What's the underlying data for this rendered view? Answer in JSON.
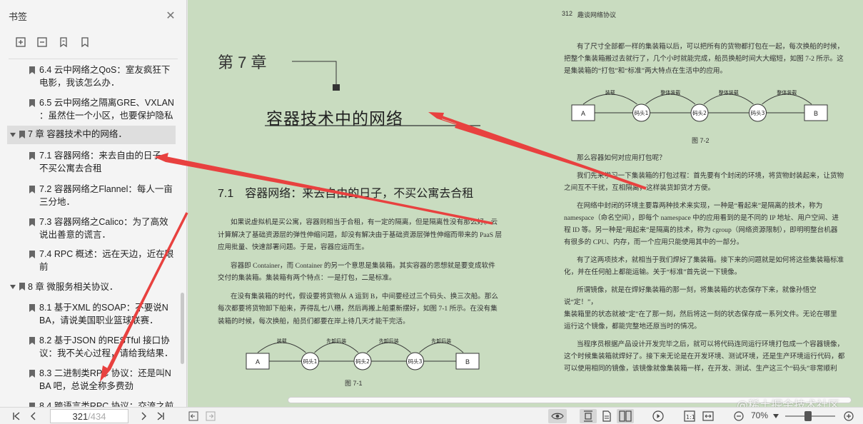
{
  "sidebar": {
    "title": "书签",
    "bookmarks": [
      {
        "l1": "6.4 云中网络之QoS：室友疯狂下",
        "l2": "电影，我该怎么办．"
      },
      {
        "l1": "6.5 云中网络之隔离GRE、VXLAN",
        "l2": "：虽然住一个小区，也要保护隐私"
      },
      {
        "l1": "7 章 容器技术中的网络．",
        "l2": ""
      },
      {
        "l1": "7.1 容器网络：来去自由的日子",
        "l2": "不买公寓去合租"
      },
      {
        "l1": "7.2 容器网络之Flannel：每人一亩",
        "l2": "三分地．"
      },
      {
        "l1": "7.3 容器网络之Calico：为了高效",
        "l2": "说出善意的谎言．"
      },
      {
        "l1": "7.4 RPC 概述：远在天边，近在眼",
        "l2": "前"
      },
      {
        "l1": "8 章 微服务相关协议．",
        "l2": ""
      },
      {
        "l1": "8.1 基于XML 的SOAP：不要说N",
        "l2": "BA，请说美国职业篮球联赛．"
      },
      {
        "l1": "8.2 基于JSON 的RESTful 接口协",
        "l2": "议：我不关心过程，请给我结果．"
      },
      {
        "l1": "8.3 二进制类RPC 协议：还是叫N",
        "l2": "BA 吧，总说全称多费劲"
      },
      {
        "l1": "8.4 跨语言类RPC 协议：交流之前",
        "l2": ""
      }
    ]
  },
  "document": {
    "left_page": {
      "chapter_label": "第 7 章",
      "chapter_title": "容器技术中的网络",
      "section_title": "7.1　容器网络：来去自由的日子，不买公寓去合租",
      "paragraphs": [
        "如果说虚拟机是买公寓，容器则相当于合租，有一定的隔离，但是隔离性没有那么好。云",
        "计算解决了基础资源层的弹性伸缩问题，却没有解决由于基础资源层弹性伸缩而带来的 PaaS 层",
        "应用批量、快速部署问题。于是，容器应运而生。",
        "容器即 Container，而 Container 的另一个意思是集装箱。其实容器的思想就是要变成软件",
        "交付的集装箱。集装箱有两个特点：一是打包，二是标准。",
        "在没有集装箱的时代，假设要将货物从 A 运到 B，中间要经过三个码头、换三次船。那么",
        "每次都要将货物卸下船来，弄得乱七八糟，然后再搬上船重新摆好，如图 7-1 所示。在没有集",
        "装箱的时候，每次换船，船员们都要在岸上待几天才能干完活。"
      ],
      "figure": {
        "caption": "图 7-1",
        "start": "A",
        "end": "B",
        "nodes": [
          "码头1",
          "码头2",
          "码头3"
        ],
        "arcs": [
          "装载",
          "先卸后装",
          "先卸后装",
          "先卸后装"
        ]
      }
    },
    "right_page": {
      "header_page": "312",
      "header_title": "趣谈网络协议",
      "paragraphs_top": [
        "有了尺寸全部都一样的集装箱以后，可以把所有的货物都打包在一起，每次换船的时候，",
        "把整个集装箱搬过去就行了，几个小时就能完成，船员换船时间大大缩短，如图 7-2 所示。这",
        "是集装箱的“打包”和“标准”两大特点在生活中的应用。"
      ],
      "figure": {
        "caption": "图 7-2",
        "start": "A",
        "end": "B",
        "nodes": [
          "码头1",
          "码头2",
          "码头3"
        ],
        "arcs": [
          "装载",
          "整体装载",
          "整体装载",
          "整体装载"
        ]
      },
      "paragraphs_bottom": [
        "那么容器如何对应用打包呢？",
        "我们先来学习一下集装箱的打包过程：首先要有个封闭的环境，将货物封装起来，让货物",
        "之间互不干扰，互相隔离，这样装货卸货才方便。",
        "在网络中封闭的环境主要靠两种技术来实现，一种是“看起来”是隔离的技术，称为",
        "namespace（命名空间），即每个 namespace 中的应用看到的是不同的 IP 地址、用户空间、进",
        "程 ID 等。另一种是“用起来”是隔离的技术，称为 cgroup（网络资源限制），即明明整台机器",
        "有很多的 CPU、内存，而一个应用只能使用其中的一部分。",
        "有了这两项技术，就相当于我们焊好了集装箱。接下来的问题就是如何将这些集装箱标准",
        "化，并在任何船上都能运输。关于“标准”首先说一下镜像。",
        "所谓镜像，就是在焊好集装箱的那一刻，将集装箱的状态保存下来，就像孙悟空说“定！”，",
        "集装箱里的状态就被“定”在了那一刻，然后将这一刻的状态保存成一系列文件。无论在哪里",
        "运行这个镜像，都能完整地还原当时的情况。",
        "当程序员根据产品设计开发完毕之后，就可以将代码连同运行环境打包成一个容器镜像，",
        "这个时候集装箱就焊好了。接下来无论是在开发环境、测试环境，还是生产环境运行代码，都",
        "可以使用相同的镜像，该镜像就像集装箱一样，在开发、测试、生产这三个“码头”非常顺利"
      ]
    }
  },
  "bottombar": {
    "current_page": "321",
    "total_pages": "/434",
    "zoom": "70%"
  },
  "watermark": "@稀土掘金技术社区",
  "colors": {
    "page_bg": "#c9dcc0",
    "annotation_arrow": "#e8413f"
  }
}
